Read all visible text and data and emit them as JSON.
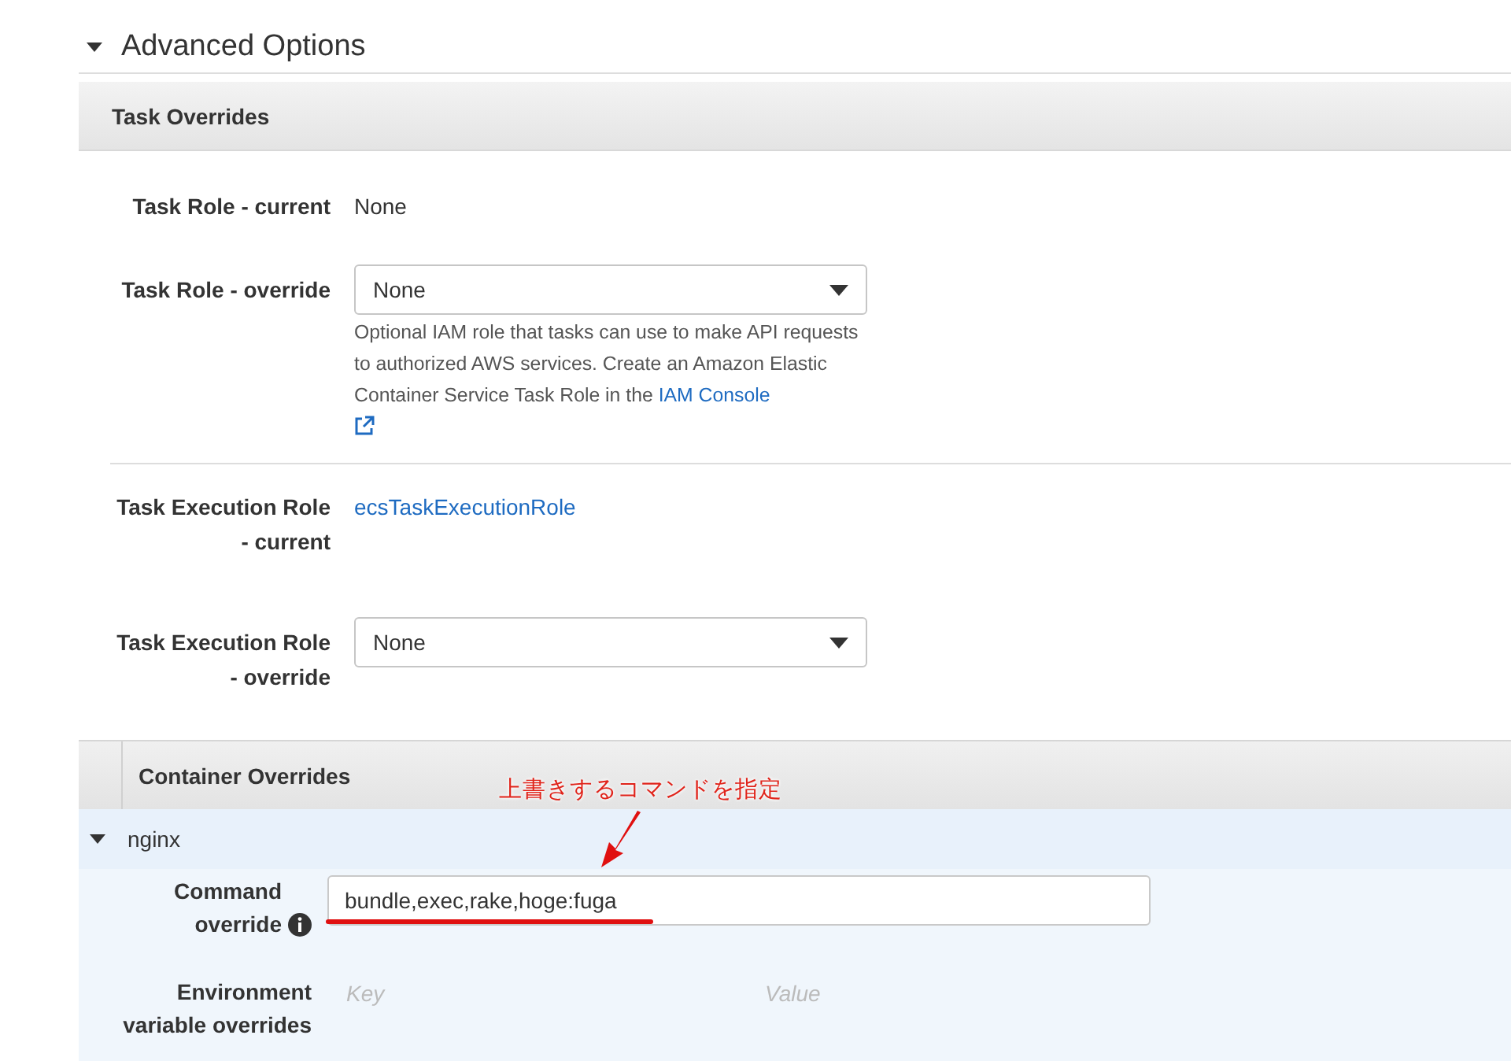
{
  "advanced_options": {
    "title": "Advanced Options",
    "expanded": true
  },
  "task_overrides": {
    "title": "Task Overrides",
    "task_role_current": {
      "label": "Task Role - current",
      "value": "None"
    },
    "task_role_override": {
      "label": "Task Role - override",
      "value": "None",
      "help": "Optional IAM role that tasks can use to make API requests to authorized AWS services. Create an Amazon Elastic Container Service Task Role in the ",
      "help_link": "IAM Console"
    },
    "execution_role_current": {
      "label": "Task Execution Role - current",
      "value": "ecsTaskExecutionRole"
    },
    "execution_role_override": {
      "label": "Task Execution Role - override",
      "value": "None"
    }
  },
  "container_overrides": {
    "title": "Container Overrides",
    "annotation": "上書きするコマンドを指定",
    "containers": [
      {
        "name": "nginx",
        "expanded": true,
        "command_override": {
          "label": "Command override",
          "value": "bundle,exec,rake,hoge:fuga"
        },
        "environment": {
          "label": "Environment variable overrides",
          "key_placeholder": "Key",
          "value_placeholder": "Value"
        }
      }
    ]
  }
}
